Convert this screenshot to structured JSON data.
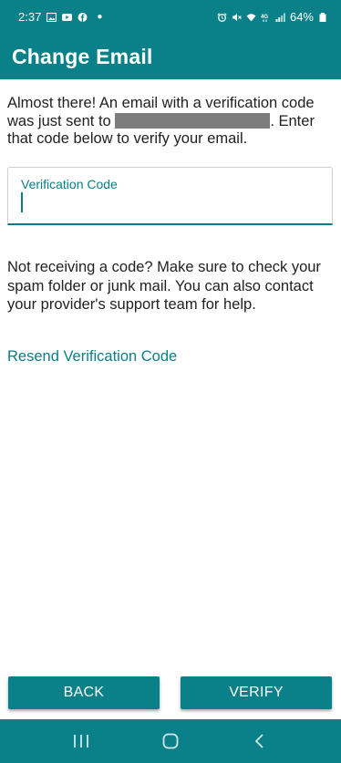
{
  "status_bar": {
    "time": "2:37",
    "battery": "64%",
    "icons": [
      "gallery-icon",
      "youtube-icon",
      "facebook-icon",
      "alarm-icon",
      "mute-icon",
      "wifi-icon",
      "4g-icon",
      "signal-icon",
      "battery-icon"
    ]
  },
  "app_bar": {
    "title": "Change Email"
  },
  "intro": {
    "text_before": "Almost there! An email with a verification code was just sent to",
    "text_after": ". Enter that code below to verify your email."
  },
  "code_field": {
    "label": "Verification Code",
    "value": ""
  },
  "help": {
    "text": "Not receiving a code? Make sure to check your spam folder or junk mail. You can also contact your provider's support team for help."
  },
  "resend_label": "Resend Verification Code",
  "buttons": {
    "back": "BACK",
    "verify": "VERIFY"
  },
  "nav": {
    "items": [
      "recent-apps-icon",
      "home-icon",
      "back-icon"
    ]
  },
  "colors": {
    "primary": "#0a8088",
    "accent": "#0a7d85",
    "redaction": "#7d7d7d"
  }
}
